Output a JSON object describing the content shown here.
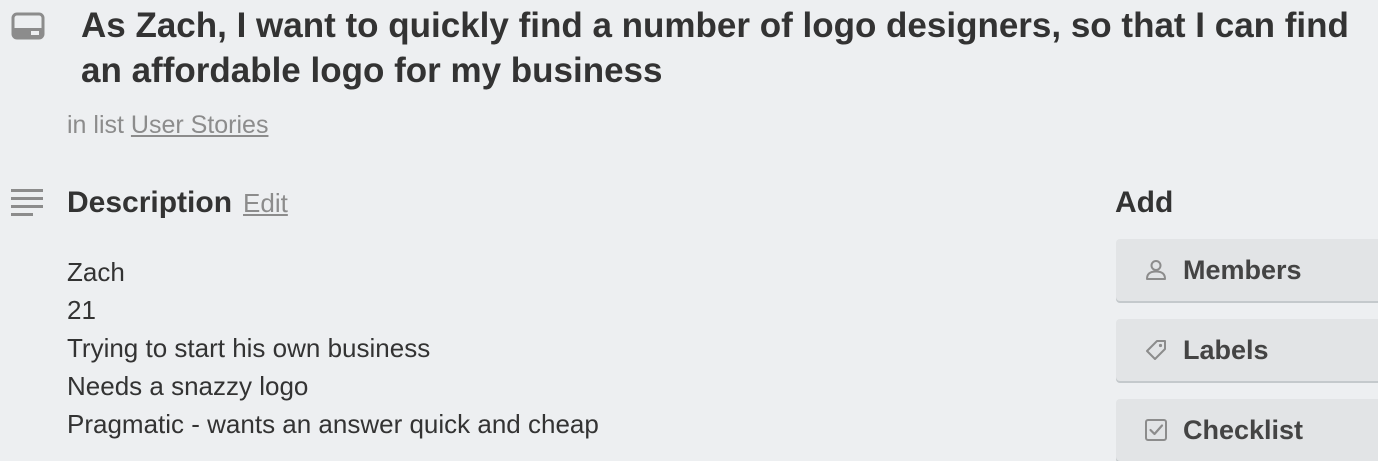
{
  "card": {
    "title": "As Zach, I want to quickly find a number of logo designers, so that I can find an affordable logo for my business",
    "in_list_prefix": "in list",
    "list_name": "User Stories"
  },
  "description": {
    "heading": "Description",
    "edit_label": "Edit",
    "lines": [
      "Zach",
      "21",
      "Trying to start his own business",
      "Needs a snazzy logo",
      "Pragmatic - wants an answer quick and cheap"
    ]
  },
  "add_panel": {
    "heading": "Add",
    "buttons": [
      {
        "label": "Members",
        "icon": "person-icon"
      },
      {
        "label": "Labels",
        "icon": "tag-icon"
      },
      {
        "label": "Checklist",
        "icon": "checkbox-icon"
      }
    ]
  },
  "colors": {
    "background": "#edeff1",
    "button_background": "#e2e4e6",
    "text": "#333333",
    "muted_text": "#8c8c8c"
  }
}
